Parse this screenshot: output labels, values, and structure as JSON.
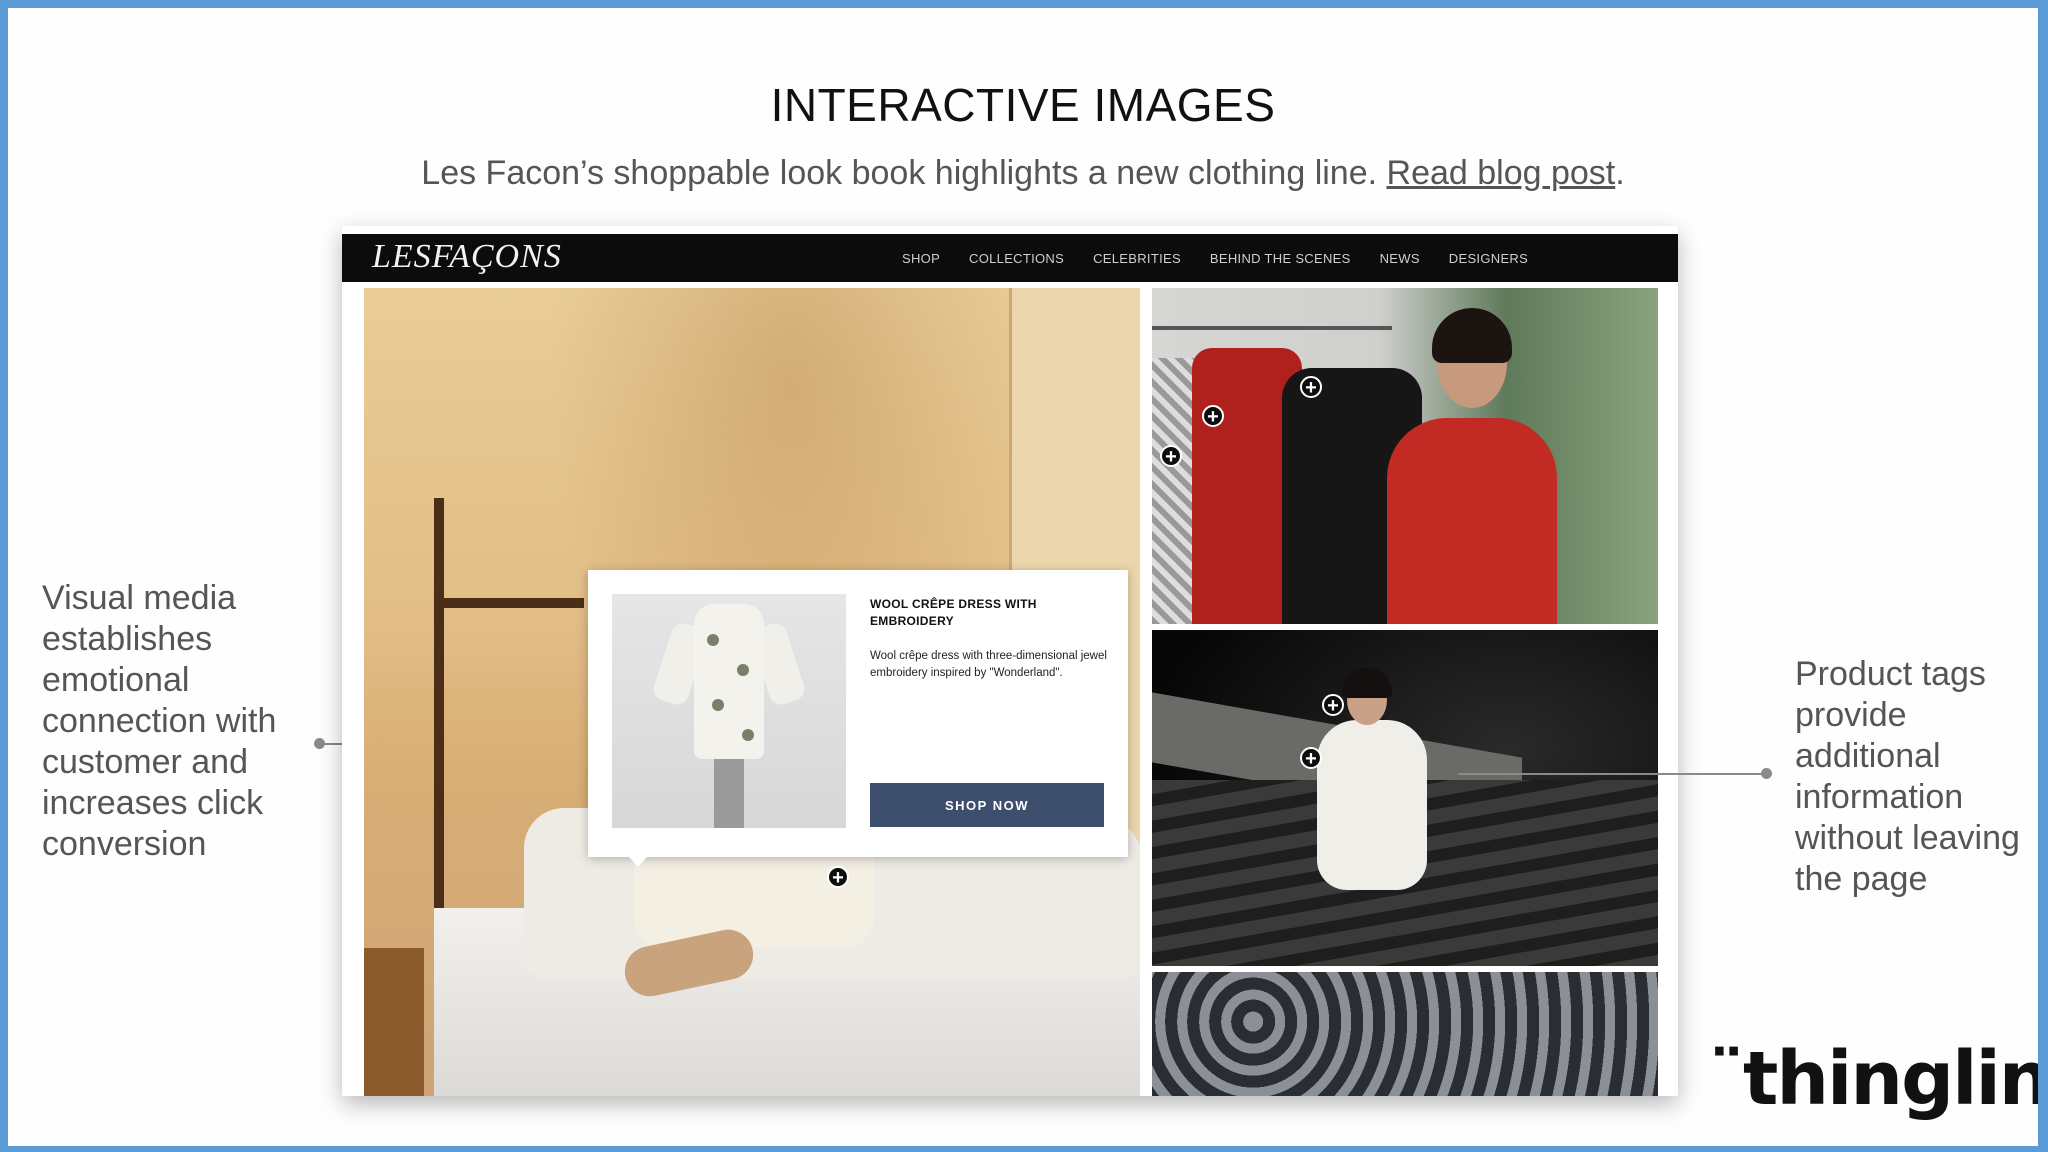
{
  "slide": {
    "title": "INTERACTIVE IMAGES",
    "subtitle": "Les Facon’s shoppable look book highlights a new clothing line. ",
    "subtitle_link": "Read blog post",
    "subtitle_end": ".",
    "left_note": "Visual media establishes emotional connection with customer and increases click conversion",
    "right_note": "Product tags provide additional information without leaving the page",
    "brand_logo": "¨thinglink.."
  },
  "site": {
    "logo": "LESFAÇONS",
    "nav": [
      "SHOP",
      "COLLECTIONS",
      "CELEBRITIES",
      "BEHIND THE SCENES",
      "NEWS",
      "DESIGNERS"
    ],
    "popup": {
      "title": "WOOL CRÊPE DRESS WITH EMBROIDERY",
      "description": "Wool crêpe dress with three-dimensional jewel embroidery inspired by \"Wonderland\".",
      "button": "SHOP NOW"
    },
    "tag_icon": "+"
  },
  "colors": {
    "frame": "#5b9bd8",
    "button": "#3d4f6c",
    "header": "#0c0c0c"
  }
}
